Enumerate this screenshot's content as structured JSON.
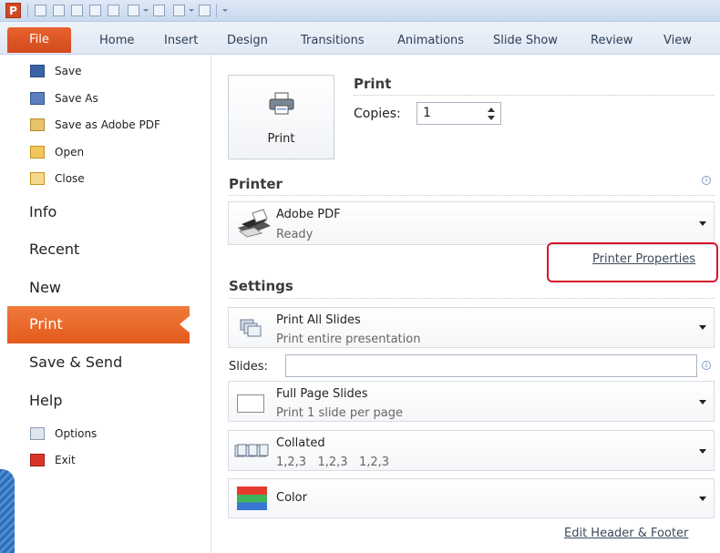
{
  "app": {
    "icon_letter": "P"
  },
  "ribbon": {
    "file_tab": "File",
    "tabs": [
      "Home",
      "Insert",
      "Design",
      "Transitions",
      "Animations",
      "Slide Show",
      "Review",
      "View"
    ]
  },
  "nav": {
    "save": "Save",
    "save_as": "Save As",
    "save_pdf": "Save as Adobe PDF",
    "open": "Open",
    "close": "Close",
    "info": "Info",
    "recent": "Recent",
    "new": "New",
    "print": "Print",
    "save_send": "Save & Send",
    "help": "Help",
    "options": "Options",
    "exit": "Exit"
  },
  "print": {
    "button_label": "Print",
    "section_title": "Print",
    "copies_label": "Copies:",
    "copies_value": "1"
  },
  "printer": {
    "section_title": "Printer",
    "name": "Adobe PDF",
    "status": "Ready",
    "properties_link": "Printer Properties"
  },
  "settings": {
    "section_title": "Settings",
    "range": {
      "title": "Print All Slides",
      "subtitle": "Print entire presentation"
    },
    "slides_label": "Slides:",
    "slides_value": "",
    "layout": {
      "title": "Full Page Slides",
      "subtitle": "Print 1 slide per page"
    },
    "collation": {
      "title": "Collated",
      "subtitle": "1,2,3   1,2,3   1,2,3"
    },
    "color": {
      "title": "Color"
    },
    "header_footer_link": "Edit Header & Footer"
  },
  "colors": {
    "accent_orange": "#e8622f",
    "highlight_red": "#d9162a"
  }
}
